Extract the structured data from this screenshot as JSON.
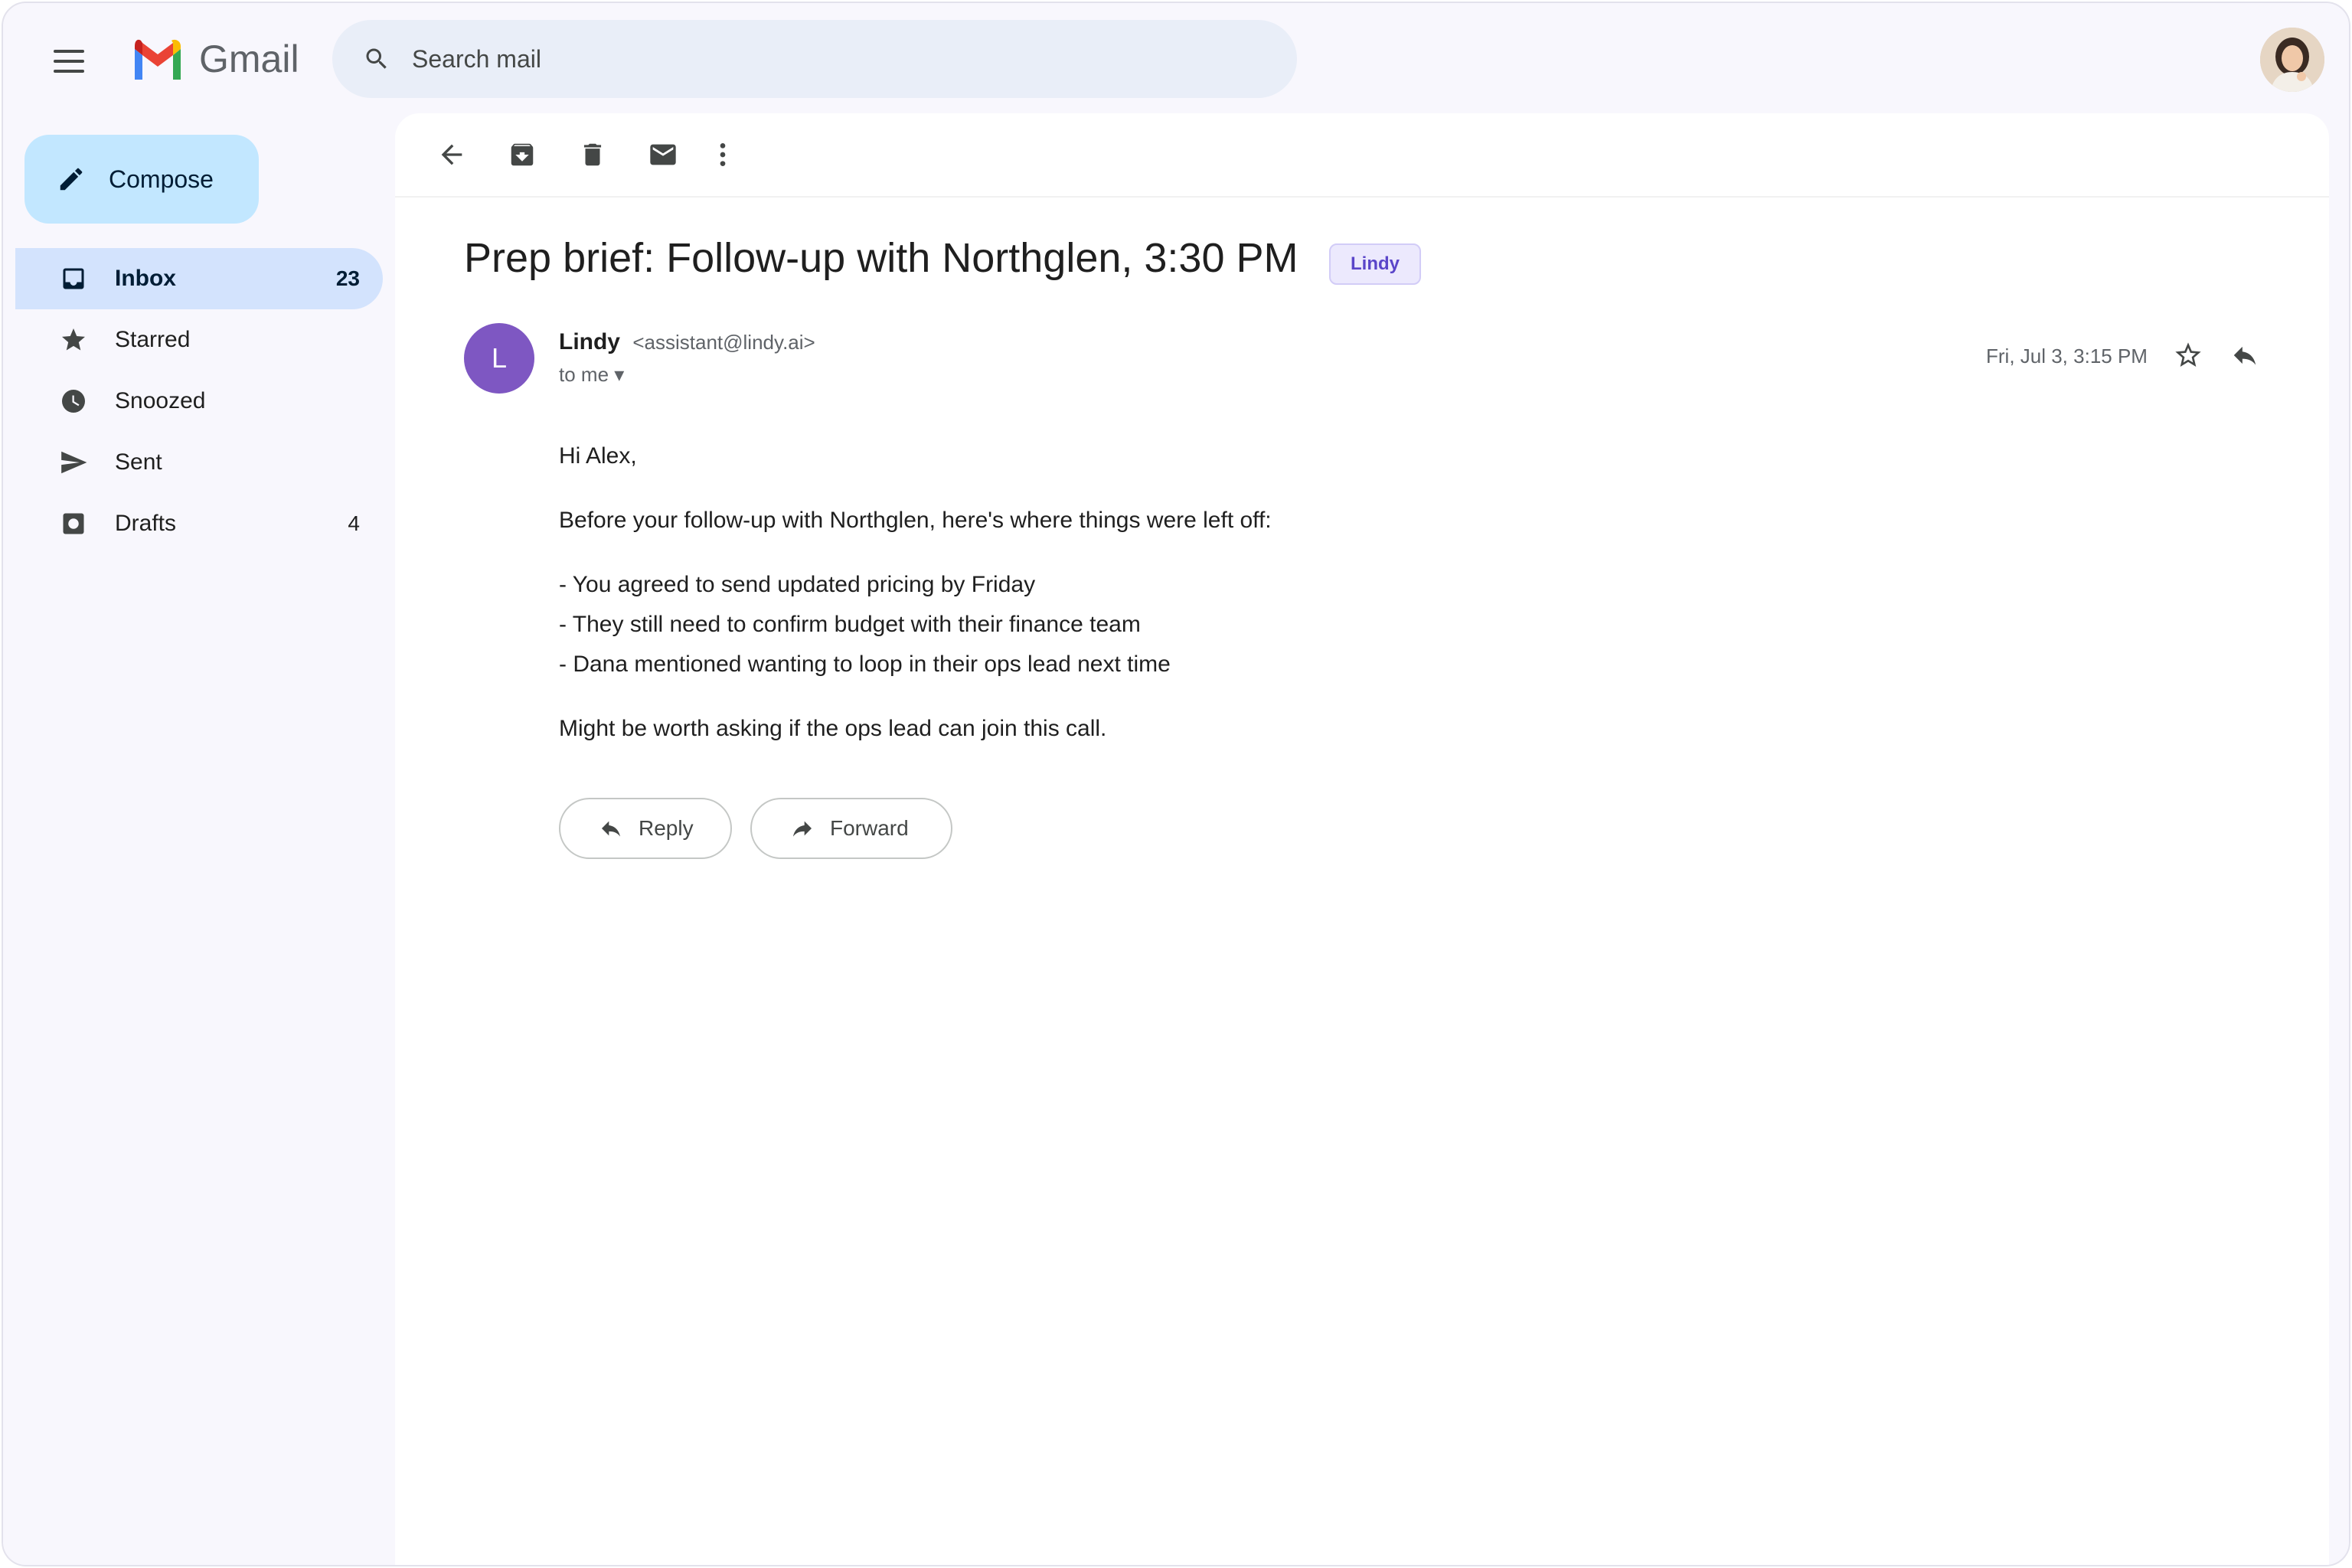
{
  "header": {
    "app_name": "Gmail",
    "search_placeholder": "Search mail"
  },
  "sidebar": {
    "compose_label": "Compose",
    "items": [
      {
        "label": "Inbox",
        "count": "23"
      },
      {
        "label": "Starred",
        "count": ""
      },
      {
        "label": "Snoozed",
        "count": ""
      },
      {
        "label": "Sent",
        "count": ""
      },
      {
        "label": "Drafts",
        "count": "4"
      }
    ]
  },
  "message": {
    "subject": "Prep brief: Follow-up with Northglen, 3:30 PM",
    "label": "Lindy",
    "sender_initial": "L",
    "sender_name": "Lindy",
    "sender_email": "<assistant@lindy.ai>",
    "to_line": "to me ▾",
    "date": "Fri, Jul 3, 3:15 PM",
    "body": {
      "greeting": "Hi Alex,",
      "intro": "Before your follow-up with Northglen, here's where things were left off:",
      "bullets": [
        "- You agreed to send updated pricing by Friday",
        "- They still need to confirm budget with their finance team",
        "- Dana mentioned wanting to loop in their ops lead next time"
      ],
      "closing": "Might be worth asking if the ops lead can join this call."
    },
    "reply_label": "Reply",
    "forward_label": "Forward"
  },
  "colors": {
    "accent_active": "#d3e3fd",
    "compose_bg": "#c2e7ff",
    "sender_avatar": "#7e57c2",
    "label_chip_text": "#5a45c9"
  },
  "icons": [
    "menu-icon",
    "gmail-logo",
    "search-icon",
    "pencil-icon",
    "inbox-icon",
    "star-icon",
    "clock-icon",
    "send-icon",
    "draft-icon",
    "back-arrow-icon",
    "archive-icon",
    "trash-icon",
    "mail-icon",
    "more-vert-icon",
    "reply-icon",
    "forward-icon"
  ]
}
